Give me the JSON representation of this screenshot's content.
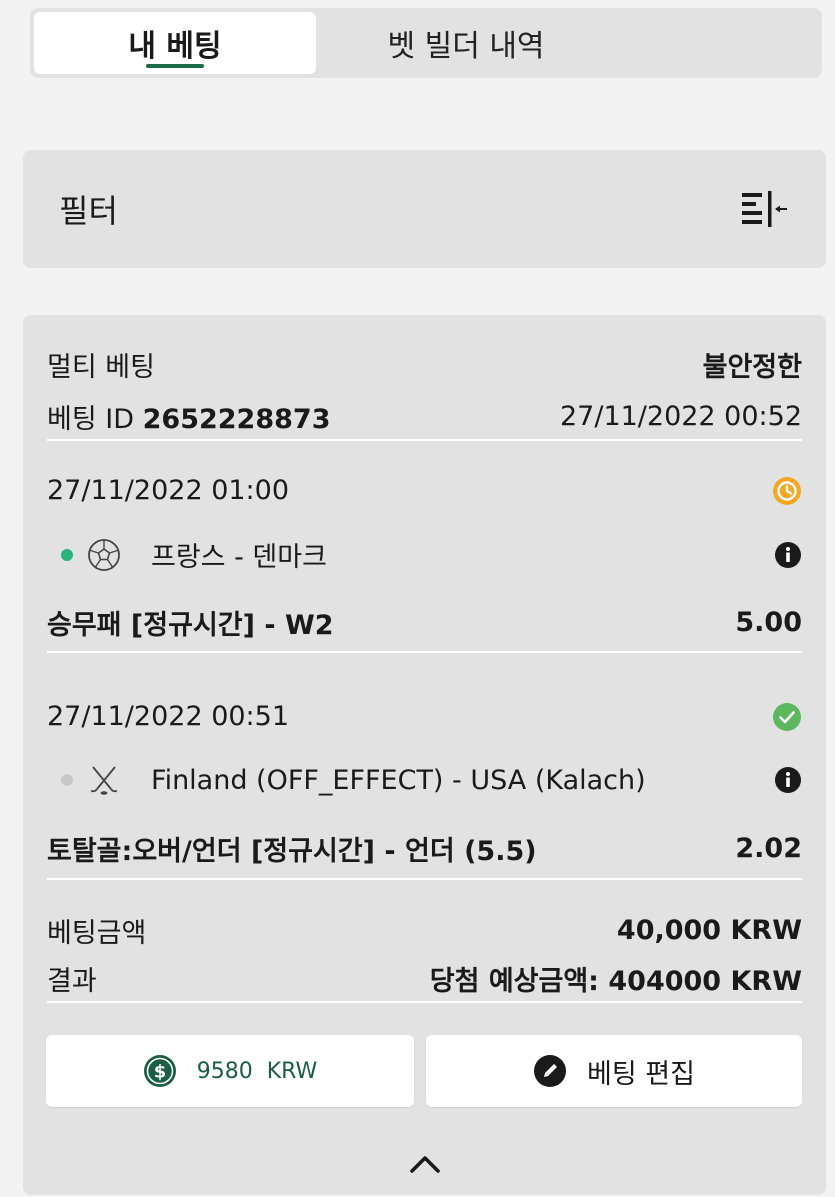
{
  "tabs": [
    {
      "label": "내 베팅",
      "active": true
    },
    {
      "label": "벳 빌더 내역",
      "active": false
    }
  ],
  "filter": {
    "label": "필터",
    "icon": "filter-collapse-icon"
  },
  "bet": {
    "type": "멀티 베팅",
    "status": "불안정한",
    "id_label": "베팅 ID",
    "id_value": "2652228873",
    "placed_at": "27/11/2022 00:52",
    "selections": [
      {
        "datetime": "27/11/2022 01:00",
        "status_icon": "clock-icon",
        "status_color": "#f5a623",
        "live_dot_color": "#2ab27b",
        "sport_icon": "soccer-ball-icon",
        "event": "프랑스 - 덴마크",
        "market": "승무패 [정규시간] - W2",
        "odds": "5.00"
      },
      {
        "datetime": "27/11/2022 00:51",
        "status_icon": "check-icon",
        "status_color": "#5cb85c",
        "live_dot_color": "#c8c8c8",
        "sport_icon": "hockey-sticks-icon",
        "event": "Finland (OFF_EFFECT) - USA (Kalach)",
        "market": "토탈골:오버/언더 [정규시간] - 언더 (5.5)",
        "odds": "2.02"
      }
    ],
    "stake_label": "베팅금액",
    "stake_value": "40,000 KRW",
    "result_label": "결과",
    "potential_win": "당첨 예상금액: 404000 KRW",
    "cashout_button": "9580  KRW",
    "edit_button": "베팅 편집"
  },
  "colors": {
    "accent": "#1b6a4a",
    "card_bg": "#e2e2e2",
    "page_bg": "#f3f3f3"
  }
}
